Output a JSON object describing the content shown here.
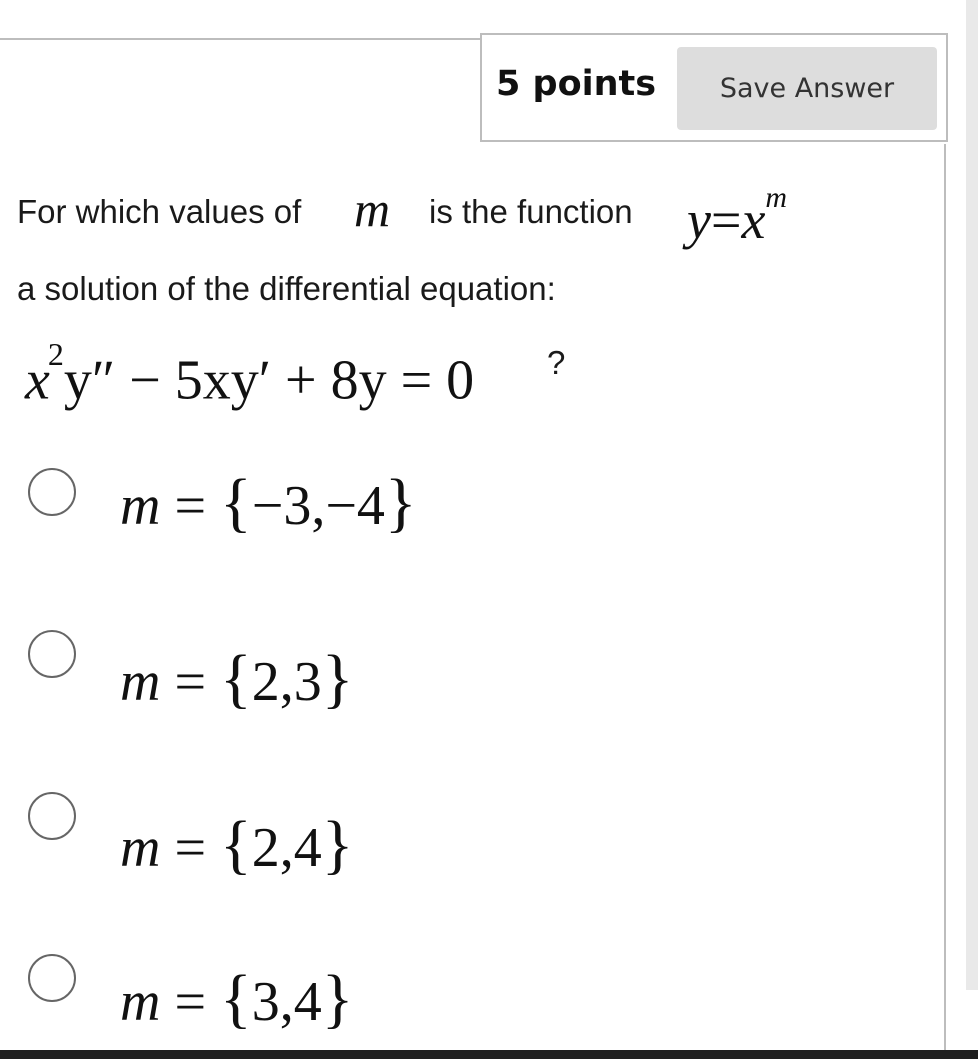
{
  "header": {
    "points_label": "5 points",
    "save_button_label": "Save Answer"
  },
  "question": {
    "line1_text_a": "For which values of",
    "line1_variable": "m",
    "line1_text_b": "is the function",
    "function_lhs": "y",
    "function_eq": "=",
    "function_base": "x",
    "function_exponent": "m",
    "line2_text": "a solution of the differential equation:",
    "equation_part1": "x",
    "equation_exp": "2",
    "equation_part2": "y″ − 5xy′ + 8y = 0",
    "question_mark": "?"
  },
  "options": [
    {
      "variable": "m",
      "equals": " = ",
      "set": "−3,−4",
      "selected": false
    },
    {
      "variable": "m",
      "equals": " = ",
      "set": "2,3",
      "selected": false
    },
    {
      "variable": "m",
      "equals": " = ",
      "set": "2,4",
      "selected": false
    },
    {
      "variable": "m",
      "equals": " = ",
      "set": "3,4",
      "selected": false
    }
  ],
  "colors": {
    "button_bg": "#dddddd",
    "border": "#bdbdbd",
    "text": "#1a1a1a"
  },
  "icons": {
    "option_marker": "radio-unselected-icon"
  }
}
